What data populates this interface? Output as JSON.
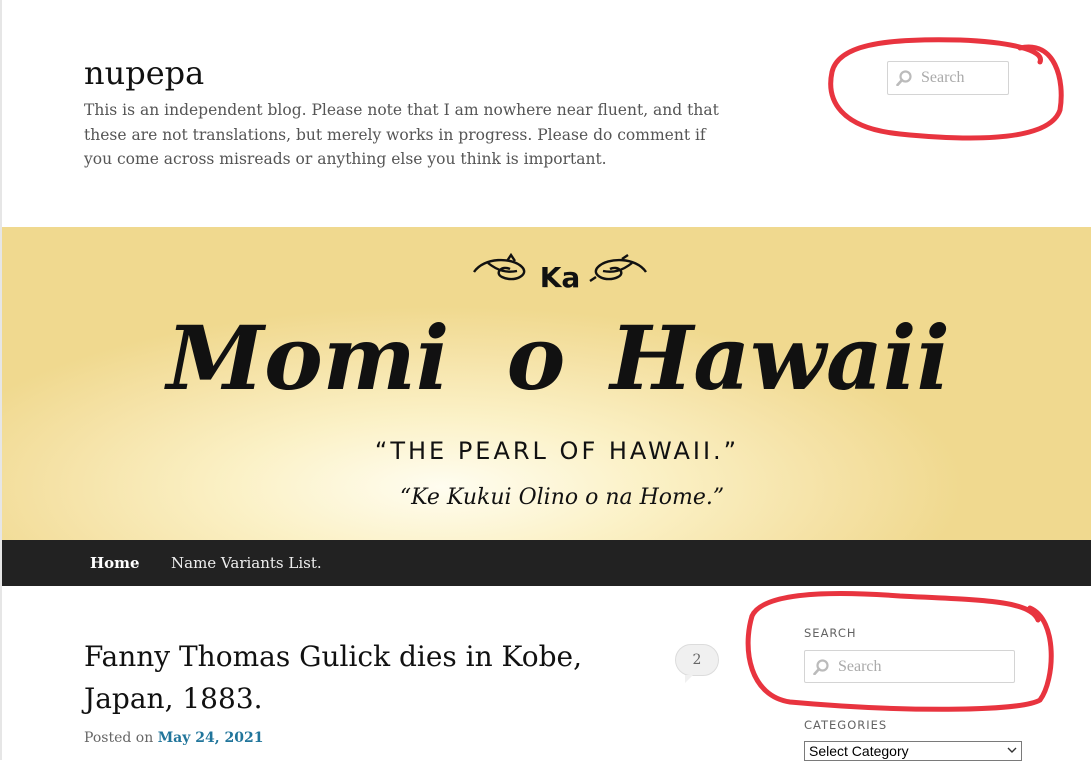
{
  "site": {
    "title": "nupepa",
    "description": "This is an independent blog. Please note that I am nowhere near fluent, and that these are not translations, but merely works in progress. Please do comment if you come across misreads or anything else you think is important."
  },
  "header_search": {
    "placeholder": "Search"
  },
  "banner": {
    "ka": "Ka",
    "word1": "Momi",
    "word2": "o",
    "word3": "Hawaii",
    "subtitle": "“THE PEARL OF HAWAII.”",
    "tagline": "“Ke Kukui Olino o na Home.”"
  },
  "nav": {
    "items": [
      {
        "label": "Home"
      },
      {
        "label": "Name Variants List."
      }
    ]
  },
  "post": {
    "title": "Fanny Thomas Gulick dies in Kobe, Japan, 1883.",
    "comment_count": "2",
    "posted_on": "Posted on",
    "date": "May 24, 2021"
  },
  "sidebar": {
    "search_title": "SEARCH",
    "search_placeholder": "Search",
    "categories_title": "CATEGORIES",
    "categories_selected": "Select Category"
  },
  "annotations": {
    "color": "#e8343f"
  },
  "icons": {
    "search": "magnifier-icon",
    "select": "chevron-down-icon"
  }
}
